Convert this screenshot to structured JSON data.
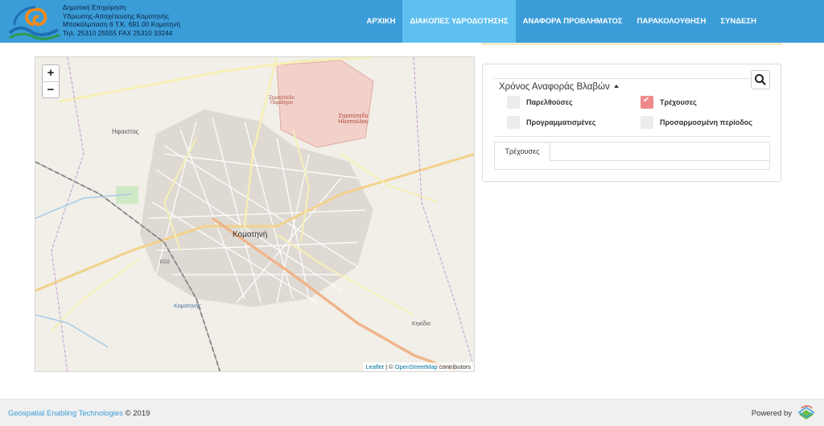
{
  "header": {
    "org_lines": [
      "Δημοτική Επιχείρηση",
      "Υδρευσης-Αποχέτευσης Κομοτηνής",
      "Μπακάλμπαση 6  Τ.Κ. 691 00  Κομοτηνή",
      "Τηλ. 25310 25555     FAX 25310 33244"
    ],
    "nav": [
      {
        "label": "ΑΡΧΙΚΗ",
        "active": false
      },
      {
        "label": "ΔΙΑΚΟΠΕΣ ΥΔΡΟΔΟΤΗΣΗΣ",
        "active": true
      },
      {
        "label": "ΑΝΑΦΟΡΑ ΠΡΟΒΛΗΜΑΤΟΣ",
        "active": false
      },
      {
        "label": "ΠΑΡΑΚΟΛΟΥΘΗΣΗ",
        "active": false
      },
      {
        "label": "ΣΥΝΔΕΣΗ",
        "active": false
      }
    ]
  },
  "map": {
    "zoom_in": "+",
    "zoom_out": "−",
    "attribution": {
      "leaflet": "Leaflet",
      "sep": " | © ",
      "osm": "OpenStreetMap",
      "suffix": " contributors"
    },
    "labels": {
      "city": "Κομοτηνή",
      "hfaistos": "Ηφαιστος",
      "camp1": "Στρατόπεδο Ηλιοπούλου",
      "camp2": "Στρατόπεδο Παράσχου",
      "kikidio": "Κηκίδιο",
      "station": "Κομοτηνής",
      "e02": "ΕΟ2"
    }
  },
  "panel": {
    "title": "Χρόνος Αναφοράς Βλαβών",
    "options": [
      {
        "label": "Παρελθούσες",
        "checked": false
      },
      {
        "label": "Τρέχουσες",
        "checked": true
      },
      {
        "label": "Προγραμματισμένες",
        "checked": false
      },
      {
        "label": "Προσαρμοσμένη περίοδος",
        "checked": false
      }
    ],
    "tab": "Τρέχουσες"
  },
  "footer": {
    "company": "Geospatial Enabling Technologies",
    "copyright": " © 2019",
    "powered": "Powered by"
  },
  "colors": {
    "nav": "#3b9dd8",
    "nav_active": "#5fc0f0",
    "checked": "#f08a8a"
  }
}
